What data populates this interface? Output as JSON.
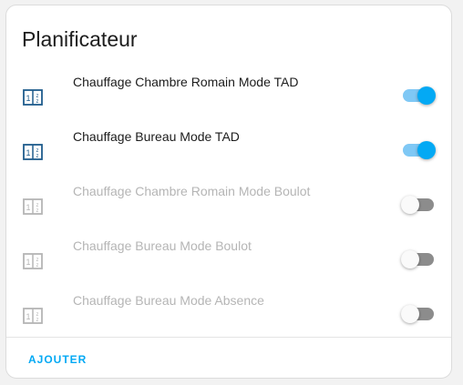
{
  "card": {
    "title": "Planificateur",
    "add_label": "AJOUTER"
  },
  "colors": {
    "accent": "#03a9f4",
    "icon_active": "#1f5c8c",
    "icon_inactive": "#b5b5b5"
  },
  "schedules": [
    {
      "label": "Chauffage Chambre Romain Mode TAD",
      "enabled": true,
      "icon": "calendar-clock-icon"
    },
    {
      "label": "Chauffage Bureau Mode TAD",
      "enabled": true,
      "icon": "calendar-clock-icon"
    },
    {
      "label": "Chauffage Chambre Romain Mode Boulot",
      "enabled": false,
      "icon": "calendar-clock-icon"
    },
    {
      "label": "Chauffage Bureau Mode Boulot",
      "enabled": false,
      "icon": "calendar-clock-icon"
    },
    {
      "label": "Chauffage Bureau Mode Absence",
      "enabled": false,
      "icon": "calendar-clock-icon"
    }
  ]
}
